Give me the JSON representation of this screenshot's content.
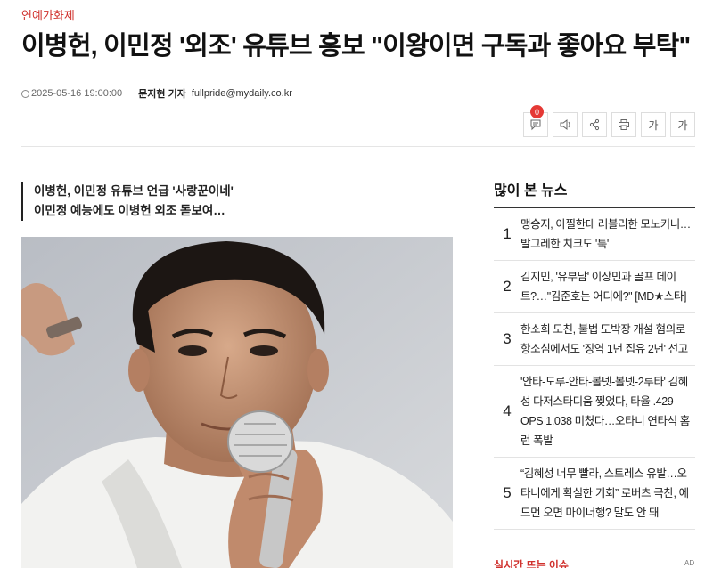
{
  "article": {
    "category": "연예가화제",
    "headline": "이병헌, 이민정 '외조' 유튜브 홍보 \"이왕이면 구독과 좋아요 부탁\"",
    "date": "2025-05-16 19:00:00",
    "reporter": "문지현 기자",
    "email": "fullpride@mydaily.co.kr",
    "summary": [
      "이병헌, 이민정 유튜브 언급 '사랑꾼이네'",
      "이민정 예능에도 이병헌 외조 돋보여…"
    ]
  },
  "toolbar": {
    "comment_count": "0",
    "font_up": "가",
    "font_down": "가",
    "icons": [
      "comment-icon",
      "speaker-icon",
      "share-icon",
      "print-icon"
    ]
  },
  "sidebar": {
    "title": "많이 본 뉴스",
    "items": [
      {
        "rank": "1",
        "text": "맹승지, 아찔한데 러블리한 모노키니… 발그레한 치크도 '툭'"
      },
      {
        "rank": "2",
        "text": "김지민, '유부남' 이상민과 골프 데이트?…\"김준호는 어디에?\" [MD★스타]"
      },
      {
        "rank": "3",
        "text": "한소희 모친, 불법 도박장 개설 혐의로 항소심에서도 '징역 1년 집유 2년' 선고"
      },
      {
        "rank": "4",
        "text": "'안타-도루-안타-볼넷-볼넷-2루타' 김혜성 다저스타디움 찢었다, 타율 .429 OPS 1.038 미쳤다…오타니 연타석 홈런 폭발"
      },
      {
        "rank": "5",
        "text": "“김혜성 너무 빨라, 스트레스 유발…오타니에게 확실한 기회” 로버츠 극찬, 에드먼 오면 마이너행? 말도 안 돼"
      }
    ]
  },
  "bottom": {
    "section_label": "실시간 뜨는 이슈",
    "ad_label": "AD"
  },
  "colors": {
    "accent": "#d0312d",
    "badge": "#e53935"
  }
}
